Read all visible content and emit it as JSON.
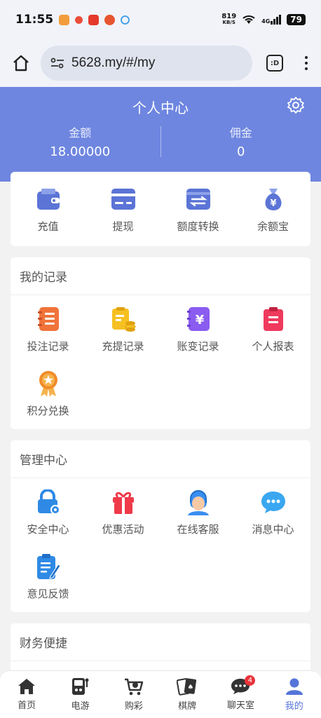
{
  "status": {
    "time": "11:55",
    "speed_value": "819",
    "speed_unit": "KB/S",
    "net": "4G",
    "battery": "79"
  },
  "browser": {
    "url": "5628.my/#/my",
    "tabs_label": ":D"
  },
  "header": {
    "title": "个人中心",
    "balance_label": "金额",
    "balance_value": "18.00000",
    "commission_label": "佣金",
    "commission_value": "0"
  },
  "quick": [
    {
      "label": "充值",
      "icon": "wallet-icon",
      "color": "#5b74d6"
    },
    {
      "label": "提现",
      "icon": "card-icon",
      "color": "#5b74d6"
    },
    {
      "label": "额度转换",
      "icon": "transfer-icon",
      "color": "#5b74d6"
    },
    {
      "label": "余额宝",
      "icon": "money-bag-icon",
      "color": "#5b74d6"
    }
  ],
  "records": {
    "title": "我的记录",
    "items": [
      {
        "label": "投注记录",
        "icon": "notebook-icon",
        "color": "#f0733a"
      },
      {
        "label": "充提记录",
        "icon": "coin-clipboard-icon",
        "color": "#f6c022"
      },
      {
        "label": "账变记录",
        "icon": "yuan-book-icon",
        "color": "#8a5cf0"
      },
      {
        "label": "个人报表",
        "icon": "report-icon",
        "color": "#ef3a5d"
      },
      {
        "label": "积分兑换",
        "icon": "medal-icon",
        "color": "#f08c2a"
      }
    ]
  },
  "management": {
    "title": "管理中心",
    "items": [
      {
        "label": "安全中心",
        "icon": "lock-icon",
        "color": "#2f8ae5"
      },
      {
        "label": "优惠活动",
        "icon": "gift-icon",
        "color": "#ef3a4a"
      },
      {
        "label": "在线客服",
        "icon": "headset-icon",
        "color": "#3a8ef0"
      },
      {
        "label": "消息中心",
        "icon": "chat-bubble-icon",
        "color": "#3aa7f0"
      },
      {
        "label": "意见反馈",
        "icon": "feedback-icon",
        "color": "#2f8ae5"
      }
    ]
  },
  "finance": {
    "title": "财务便捷"
  },
  "tabbar": [
    {
      "label": "首页",
      "icon": "home-icon"
    },
    {
      "label": "电游",
      "icon": "arcade-icon"
    },
    {
      "label": "购彩",
      "icon": "lottery-cart-icon"
    },
    {
      "label": "棋牌",
      "icon": "cards-icon"
    },
    {
      "label": "聊天室",
      "icon": "chat-icon",
      "badge": "4"
    },
    {
      "label": "我的",
      "icon": "user-icon",
      "active": true
    }
  ],
  "colors": {
    "primary": "#6e86e0",
    "active": "#5474d8"
  }
}
